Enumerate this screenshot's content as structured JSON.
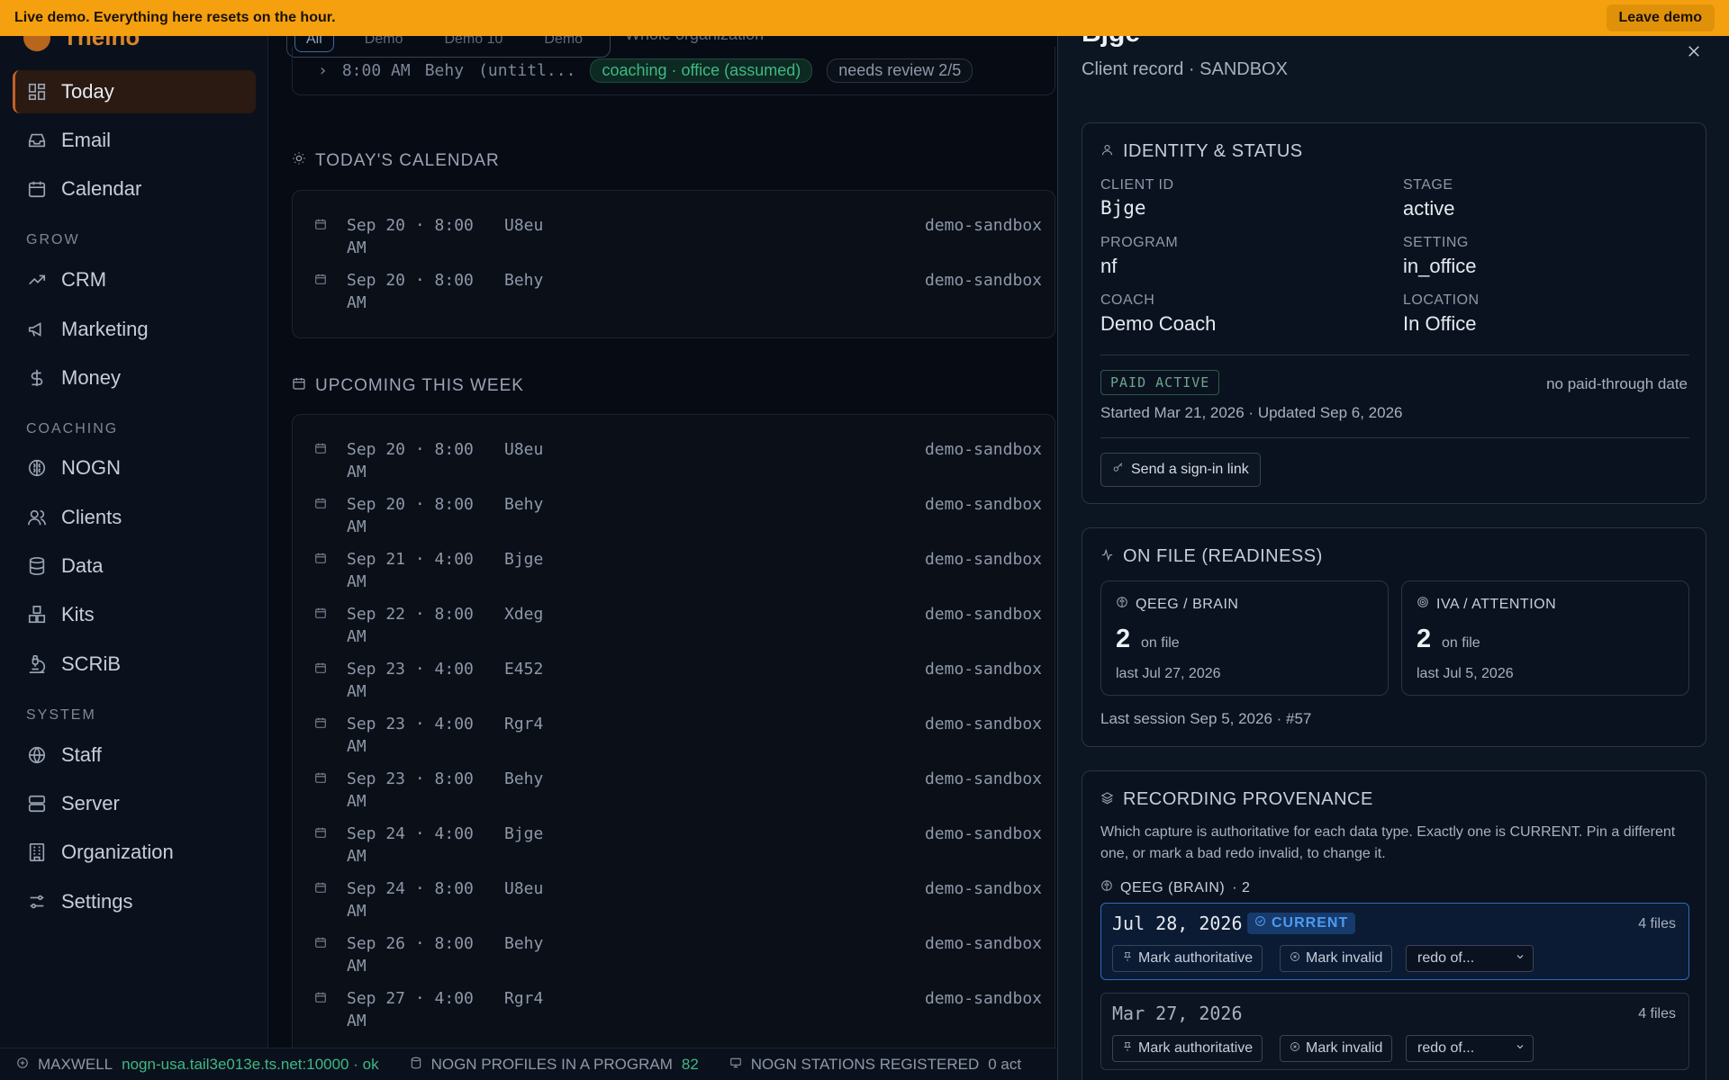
{
  "banner": {
    "text": "Live demo. Everything here resets on the hour.",
    "leave_label": "Leave demo"
  },
  "sidebar": {
    "brand": "Theino",
    "items_top": [
      {
        "label": "Today",
        "icon": "dashboard-icon",
        "active": true
      },
      {
        "label": "Email",
        "icon": "inbox-icon"
      },
      {
        "label": "Calendar",
        "icon": "calendar-icon"
      }
    ],
    "sections": [
      {
        "title": "GROW",
        "items": [
          {
            "label": "CRM",
            "icon": "trending-up-icon"
          },
          {
            "label": "Marketing",
            "icon": "megaphone-icon"
          },
          {
            "label": "Money",
            "icon": "dollar-icon"
          }
        ]
      },
      {
        "title": "COACHING",
        "items": [
          {
            "label": "NOGN",
            "icon": "brain-icon"
          },
          {
            "label": "Clients",
            "icon": "users-icon"
          },
          {
            "label": "Data",
            "icon": "database-icon"
          },
          {
            "label": "Kits",
            "icon": "boxes-icon"
          },
          {
            "label": "SCRiB",
            "icon": "microscope-icon"
          }
        ]
      },
      {
        "title": "SYSTEM",
        "items": [
          {
            "label": "Staff",
            "icon": "globe-icon"
          },
          {
            "label": "Server",
            "icon": "server-icon"
          },
          {
            "label": "Organization",
            "icon": "building-icon"
          },
          {
            "label": "Settings",
            "icon": "sliders-icon"
          }
        ]
      }
    ]
  },
  "main": {
    "scope_tabs": [
      "All",
      "Demo",
      "Demo 10",
      "Demo"
    ],
    "scope_label": "Whole organization",
    "prev_row": {
      "time": "8:00 AM",
      "name": "Behy",
      "title": "(untitl...",
      "tag": "coaching · office (assumed)",
      "status": "needs review 2/5"
    },
    "today_title": "TODAY'S CALENDAR",
    "today_events": [
      {
        "date": "Sep 20 · 8:00",
        "ampm": "AM",
        "name": "U8eu",
        "org": "demo-sandbox"
      },
      {
        "date": "Sep 20 · 8:00",
        "ampm": "AM",
        "name": "Behy",
        "org": "demo-sandbox"
      }
    ],
    "week_title": "UPCOMING THIS WEEK",
    "week_events": [
      {
        "date": "Sep 20 · 8:00",
        "ampm": "AM",
        "name": "U8eu",
        "org": "demo-sandbox"
      },
      {
        "date": "Sep 20 · 8:00",
        "ampm": "AM",
        "name": "Behy",
        "org": "demo-sandbox"
      },
      {
        "date": "Sep 21 · 4:00",
        "ampm": "AM",
        "name": "Bjge",
        "org": "demo-sandbox"
      },
      {
        "date": "Sep 22 · 8:00",
        "ampm": "AM",
        "name": "Xdeg",
        "org": "demo-sandbox"
      },
      {
        "date": "Sep 23 · 4:00",
        "ampm": "AM",
        "name": "E452",
        "org": "demo-sandbox"
      },
      {
        "date": "Sep 23 · 4:00",
        "ampm": "AM",
        "name": "Rgr4",
        "org": "demo-sandbox"
      },
      {
        "date": "Sep 23 · 8:00",
        "ampm": "AM",
        "name": "Behy",
        "org": "demo-sandbox"
      },
      {
        "date": "Sep 24 · 4:00",
        "ampm": "AM",
        "name": "Bjge",
        "org": "demo-sandbox"
      },
      {
        "date": "Sep 24 · 8:00",
        "ampm": "AM",
        "name": "U8eu",
        "org": "demo-sandbox"
      },
      {
        "date": "Sep 26 · 8:00",
        "ampm": "AM",
        "name": "Behy",
        "org": "demo-sandbox"
      },
      {
        "date": "Sep 27 · 4:00",
        "ampm": "AM",
        "name": "Rgr4",
        "org": "demo-sandbox"
      }
    ]
  },
  "statusbar": {
    "host_label": "MAXWELL",
    "host_value": "nogn-usa.tail3e013e.ts.net:10000 · ok",
    "profiles_label": "NOGN PROFILES IN A PROGRAM",
    "profiles_value": "82",
    "stations_label": "NOGN STATIONS REGISTERED",
    "stations_value": "0 act"
  },
  "panel": {
    "title": "Bjge",
    "subtitle": "Client record · SANDBOX",
    "identity": {
      "heading": "IDENTITY & STATUS",
      "client_id_label": "CLIENT ID",
      "client_id": "Bjge",
      "stage_label": "STAGE",
      "stage": "active",
      "program_label": "PROGRAM",
      "program": "nf",
      "setting_label": "SETTING",
      "setting": "in_office",
      "coach_label": "COACH",
      "coach": "Demo Coach",
      "location_label": "LOCATION",
      "location": "In Office",
      "paid_badge": "PAID ACTIVE",
      "paid_through": "no paid-through date",
      "dates": "Started Mar 21, 2026 · Updated Sep 6, 2026",
      "signin_label": "Send a sign-in link"
    },
    "readiness": {
      "heading": "ON FILE (READINESS)",
      "qeeg_label": "QEEG / BRAIN",
      "qeeg_count": "2",
      "qeeg_unit": "on file",
      "qeeg_last": "last Jul 27, 2026",
      "iva_label": "IVA / ATTENTION",
      "iva_count": "2",
      "iva_unit": "on file",
      "iva_last": "last Jul 5, 2026",
      "last_session": "Last session Sep 5, 2026 · #57"
    },
    "provenance": {
      "heading": "RECORDING PROVENANCE",
      "description": "Which capture is authoritative for each data type. Exactly one is CURRENT. Pin a different one, or mark a bad redo invalid, to change it.",
      "group_label": "QEEG (BRAIN)",
      "group_count": "· 2",
      "records": [
        {
          "date": "Jul 28, 2026",
          "current_label": "CURRENT",
          "files": "4 files",
          "pin_label": "Mark authoritative",
          "invalid_label": "Mark invalid",
          "redo_label": "redo of..."
        },
        {
          "date": "Mar 27, 2026",
          "files": "4 files",
          "pin_label": "Mark authoritative",
          "invalid_label": "Mark invalid",
          "redo_label": "redo of..."
        }
      ]
    }
  },
  "colors": {
    "banner": "#f5a00f",
    "accent_active": "#c2612a",
    "current_blue": "#4d9bf0",
    "ok_green": "#3fb884"
  }
}
